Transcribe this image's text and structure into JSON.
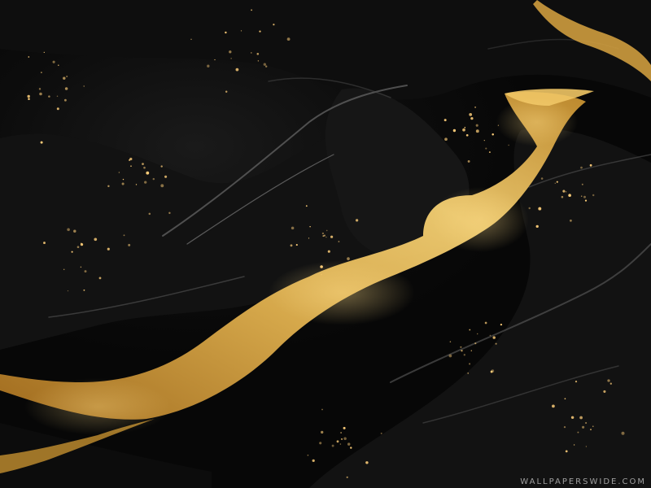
{
  "image": {
    "palette": {
      "rock_dark": "#0b0b0b",
      "rock_mid": "#2a2a2a",
      "rock_highlight": "#5a5a5a",
      "river_gold": "#d9a441",
      "river_bright": "#f4cf72",
      "city_lights": "#ffcf7a"
    }
  },
  "watermark": {
    "text": "WALLPAPERSWIDE.COM"
  }
}
